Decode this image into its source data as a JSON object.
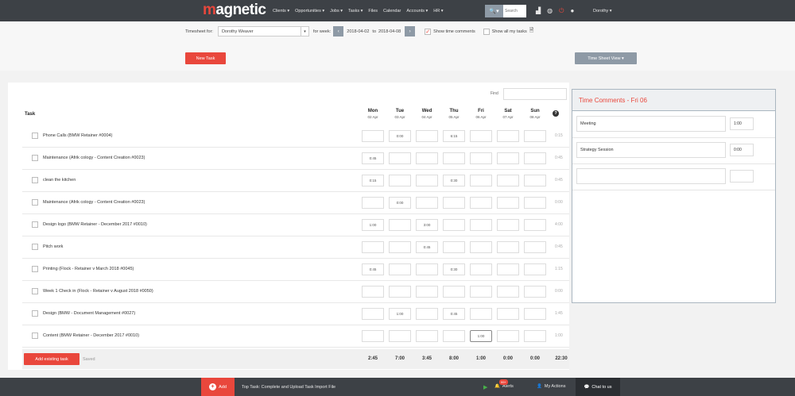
{
  "nav": {
    "logo_first": "m",
    "logo_rest": "agnetic",
    "menu": [
      "Clients ▾",
      "Opportunities ▾",
      "Jobs ▾",
      "Tasks ▾",
      "Files",
      "Calendar",
      "Accounts ▾",
      "HR ▾"
    ],
    "search_icon": "🔍▾",
    "search_placeholder": "Search",
    "user": "Dorothy ▾"
  },
  "header": {
    "timesheet_for_label": "Timesheet for:",
    "person": "Dorothy Weaver",
    "for_week_label": "for week:",
    "week_start": "2018-04-02",
    "to_label": "to",
    "week_end": "2018-04-08",
    "show_time_comments": "Show time comments",
    "show_all_tasks": "Show all my tasks",
    "new_task": "New Task",
    "time_sheet_view": "Time Sheet View ▾"
  },
  "grid": {
    "find_label": "Find",
    "task_header": "Task",
    "help": "?",
    "days": [
      {
        "name": "Mon",
        "date": "02 Apr"
      },
      {
        "name": "Tue",
        "date": "03 Apr"
      },
      {
        "name": "Wed",
        "date": "04 Apr"
      },
      {
        "name": "Thu",
        "date": "05 Apr"
      },
      {
        "name": "Fri",
        "date": "06 Apr"
      },
      {
        "name": "Sat",
        "date": "07 Apr"
      },
      {
        "name": "Sun",
        "date": "08 Apr"
      }
    ],
    "rows": [
      {
        "name": "Phone Calls (BMW Retainer #0004)",
        "cells": [
          "",
          "0:00",
          "",
          "6:15",
          "",
          "",
          ""
        ],
        "total": "0:15"
      },
      {
        "name": "Maintenance (Afrik cology - Content Creation #0023)",
        "cells": [
          "0:45",
          "",
          "",
          "",
          "",
          "",
          ""
        ],
        "total": "0:45"
      },
      {
        "name": "clean the kitchen",
        "cells": [
          "0:15",
          "",
          "",
          "0:30",
          "",
          "",
          ""
        ],
        "total": "0:45"
      },
      {
        "name": "Maintenance (Afrik cology - Content Creation #0023)",
        "cells": [
          "",
          "0:00",
          "",
          "",
          "",
          "",
          ""
        ],
        "total": "0:00"
      },
      {
        "name": "Design logo (BMW Retainer - December 2017 #0010)",
        "cells": [
          "1:00",
          "",
          "3:00",
          "",
          "",
          "",
          ""
        ],
        "total": "4:00"
      },
      {
        "name": "Pitch work",
        "cells": [
          "",
          "",
          "0:45",
          "",
          "",
          "",
          ""
        ],
        "total": "0:45"
      },
      {
        "name": "Printing (Flock - Retainer v March 2018 #0045)",
        "cells": [
          "0:45",
          "",
          "",
          "0:30",
          "",
          "",
          ""
        ],
        "total": "1:15"
      },
      {
        "name": "Week 1 Check in (Flock - Retainer v August 2018 #0050)",
        "cells": [
          "",
          "",
          "",
          "",
          "",
          "",
          ""
        ],
        "total": "0:00"
      },
      {
        "name": "Design (BMW - Document Management #0027)",
        "cells": [
          "",
          "1:00",
          "",
          "0:45",
          "",
          "",
          ""
        ],
        "total": "1:45"
      },
      {
        "name": "Content (BMW Retainer - December 2017 #0010)",
        "cells": [
          "",
          "",
          "",
          "",
          "1:00",
          "",
          ""
        ],
        "total": "1:00"
      }
    ],
    "add_existing_task": "Add existing task",
    "saved": "Saved",
    "totals": [
      "2:45",
      "7:00",
      "3:45",
      "8:00",
      "1:00",
      "0:00",
      "0:00"
    ],
    "grand_total": "22:30"
  },
  "comments": {
    "title": "Time Comments - Fri 06",
    "items": [
      {
        "text": "Meeting",
        "hours": "1:00"
      },
      {
        "text": "Strategy Session",
        "hours": "0:00"
      },
      {
        "text": "",
        "hours": ""
      }
    ]
  },
  "bottom": {
    "add": "Add",
    "top_task": "Top Task: Complete and Upload Task Import File",
    "alerts_badge": "99+",
    "alerts": "Alerts",
    "my_actions": "My Actions",
    "chat": "Chat to us"
  },
  "colors": {
    "accent": "#e9473c",
    "nav_bg": "#3d4146",
    "button_gray": "#8e9aa6"
  }
}
